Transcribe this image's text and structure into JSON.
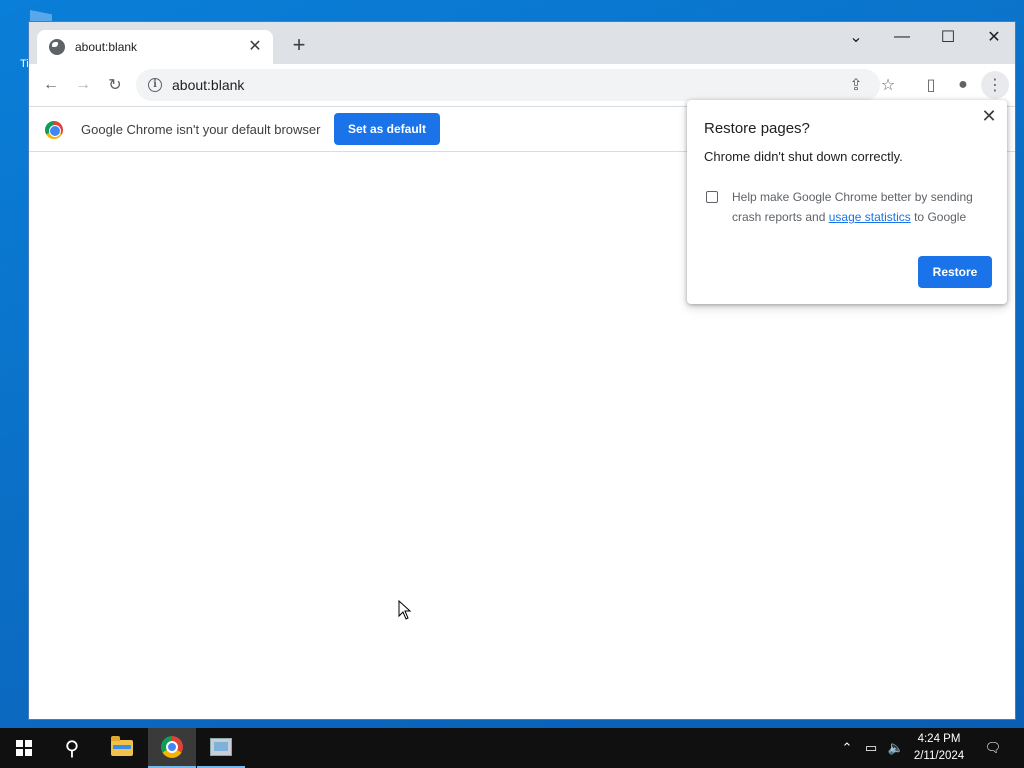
{
  "desktop": {
    "icon_label": "Ti"
  },
  "browser": {
    "tab": {
      "title": "about:blank",
      "close_glyph": "✕"
    },
    "new_tab_glyph": "+",
    "window_controls": {
      "tab_search": "⌄",
      "minimize": "—",
      "maximize": "☐",
      "close": "✕"
    },
    "toolbar": {
      "back": "←",
      "forward": "→",
      "reload": "↻",
      "url": "about:blank",
      "info_glyph": "i",
      "share": "⇪",
      "bookmark": "☆",
      "side_panel": "▯",
      "profile": "●",
      "menu": "⋮"
    },
    "infobar": {
      "message": "Google Chrome isn't your default browser",
      "button": "Set as default"
    },
    "restore_popup": {
      "close_glyph": "✕",
      "title": "Restore pages?",
      "message": "Chrome didn't shut down correctly.",
      "checkbox_checked": false,
      "consent_prefix": "Help make Google Chrome better by sending crash reports and ",
      "consent_link": "usage statistics",
      "consent_suffix": " to Google",
      "button": "Restore"
    }
  },
  "taskbar": {
    "search_glyph": "⚲",
    "tray": {
      "chevron": "⌃",
      "network": "▭",
      "volume": "🔈",
      "time": "4:24 PM",
      "date": "2/11/2024",
      "notifications": "🗨"
    }
  },
  "colors": {
    "accent": "#1a73e8",
    "desktop": "#0b6fc6",
    "taskbar": "#101010"
  }
}
